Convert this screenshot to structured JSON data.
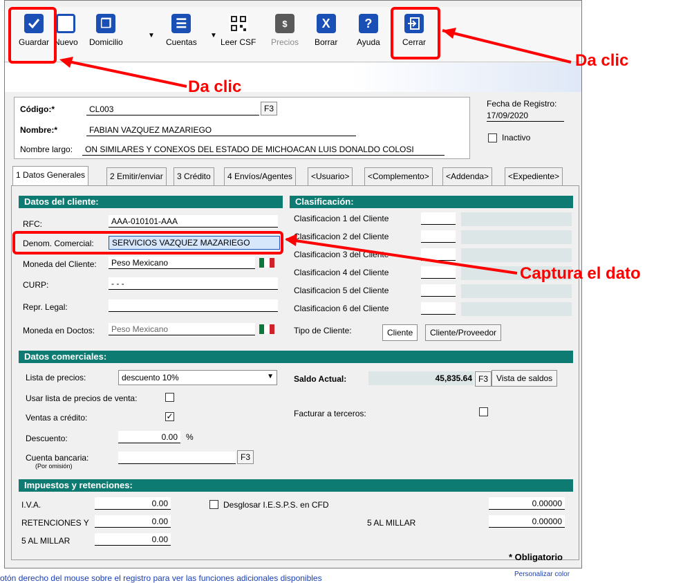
{
  "toolbar": {
    "buttons": [
      {
        "label": "Guardar",
        "icon": "check-icon"
      },
      {
        "label": "Nuevo",
        "icon": "new-document-icon"
      },
      {
        "label": "Domicilio",
        "icon": "documents-icon"
      },
      {
        "label": "Cuentas",
        "icon": "list-icon"
      },
      {
        "label": "Leer CSF",
        "icon": "qr-code-icon"
      },
      {
        "label": "Precios",
        "icon": "money-icon"
      },
      {
        "label": "Borrar",
        "icon": "delete-icon"
      },
      {
        "label": "Ayuda",
        "icon": "help-icon"
      },
      {
        "label": "Cerrar",
        "icon": "exit-door-icon"
      }
    ]
  },
  "header": {
    "codigo_label": "Código:*",
    "codigo_value": "CL003",
    "f3": "F3",
    "nombre_label": "Nombre:*",
    "nombre_value": "FABIAN VAZQUEZ MAZARIEGO",
    "nombre_largo_label": "Nombre largo:",
    "nombre_largo_value": "ON SIMILARES Y CONEXOS DEL ESTADO DE MICHOACAN LUIS DONALDO COLOSI",
    "fecha_label": "Fecha de Registro:",
    "fecha_value": "17/09/2020",
    "inactivo_label": "Inactivo"
  },
  "tabs": [
    "1 Datos Generales",
    "2 Emitir/enviar",
    "3 Crédito",
    "4 Envíos/Agentes",
    "<Usuario>",
    "<Complemento>",
    "<Addenda>",
    "<Expediente>"
  ],
  "datos_cliente": {
    "title": "Datos del cliente:",
    "rfc_label": "RFC:",
    "rfc_value": "AAA-010101-AAA",
    "denom_label": "Denom. Comercial:",
    "denom_value": "SERVICIOS VAZQUEZ MAZARIEGO",
    "moneda_label": "Moneda del Cliente:",
    "moneda_value": "Peso Mexicano",
    "curp_label": "CURP:",
    "curp_value": "-   -   -",
    "repr_label": "Repr. Legal:",
    "moneda_doc_label": "Moneda en Doctos:",
    "moneda_doc_value": "Peso Mexicano"
  },
  "clasificacion": {
    "title": "Clasificación:",
    "items": [
      "Clasificacion 1 del Cliente",
      "Clasificacion 2 del Cliente",
      "Clasificacion 3 del Cliente",
      "Clasificacion 4 del Cliente",
      "Clasificacion 5 del Cliente",
      "Clasificacion 6 del Cliente"
    ],
    "tipo_label": "Tipo de Cliente:",
    "tipo_btn1": "Cliente",
    "tipo_btn2": "Cliente/Proveedor"
  },
  "datos_comerciales": {
    "title": "Datos comerciales:",
    "lista_label": "Lista de precios:",
    "lista_value": "descuento 10%",
    "usar_lista_label": "Usar lista de precios de venta:",
    "ventas_credito_label": "Ventas a crédito:",
    "descuento_label": "Descuento:",
    "descuento_value": "0.00",
    "pct": "%",
    "cuenta_label": "Cuenta bancaria:",
    "por_omision": "(Por omisión)",
    "saldo_label": "Saldo Actual:",
    "saldo_value": "45,835.64",
    "vista_saldos": "Vista de saldos",
    "facturar_label": "Facturar a terceros:"
  },
  "impuestos": {
    "title": "Impuestos y retenciones:",
    "iva_label": "I.V.A.",
    "iva_value": "0.00",
    "ret_label": "RETENCIONES Y",
    "ret_value": "0.00",
    "millar_label": "5 AL MILLAR",
    "millar_value": "0.00",
    "desglosar_label": "Desglosar I.E.S.P.S. en CFD",
    "right1_value": "0.00000",
    "right2_label": "5 AL MILLAR",
    "right2_value": "0.00000"
  },
  "obligatorio": "* Obligatorio",
  "status_text": "otón derecho del mouse sobre el registro para ver las funciones adicionales disponibles",
  "personalizar": "Personalizar color",
  "annotations": {
    "da_clic_1": "Da clic",
    "da_clic_2": "Da clic",
    "captura": "Captura el dato"
  },
  "colors": {
    "section_header": "#0e7b72",
    "icon_blue": "#1a4fb5",
    "annotation_red": "#ff0000"
  }
}
